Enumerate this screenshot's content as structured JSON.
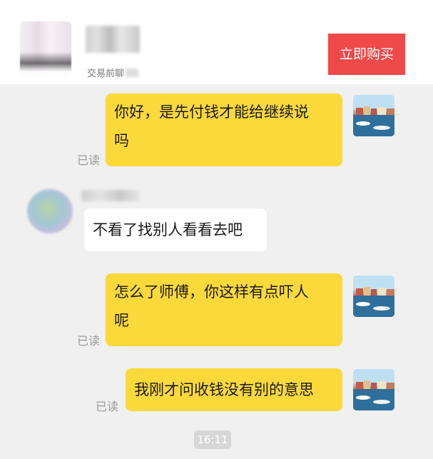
{
  "header": {
    "status_text": "交易前聊",
    "buy_button_label": "立即购买"
  },
  "messages": [
    {
      "side": "self",
      "text_line1": "你好，是先付钱才能给继续说",
      "text_line2": "吗",
      "read": "已读"
    },
    {
      "side": "other",
      "text": "不看了找别人看看去吧"
    },
    {
      "side": "self",
      "text_line1": "怎么了师傅，你这样有点吓人",
      "text_line2": "呢",
      "read": "已读"
    },
    {
      "side": "self",
      "text": "我刚才问收钱没有别的意思",
      "read": "已读"
    }
  ],
  "timestamp": "16:11",
  "colors": {
    "buy_button": "#f0494a",
    "self_bubble": "#fcd93b",
    "other_bubble": "#ffffff",
    "background": "#f0f0f0"
  }
}
